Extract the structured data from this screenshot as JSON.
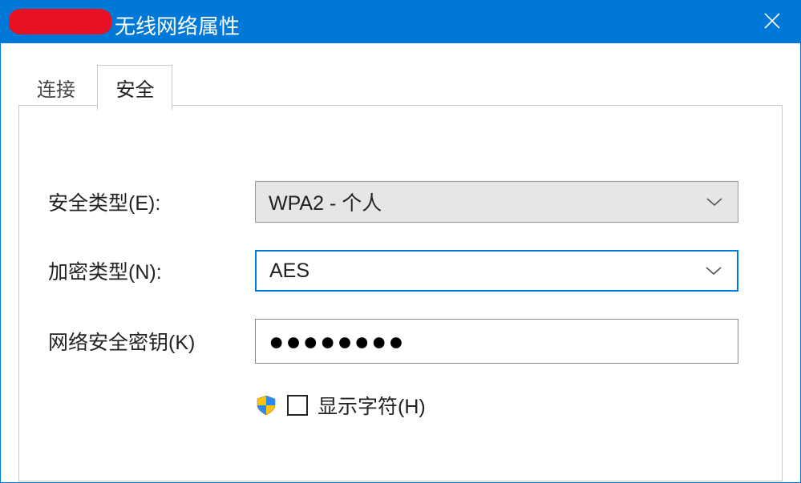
{
  "window": {
    "title": " 无线网络属性"
  },
  "tabs": {
    "connection": "连接",
    "security": "安全"
  },
  "form": {
    "security_type_label": "安全类型(E):",
    "security_type_value": "WPA2 - 个人",
    "encryption_type_label": "加密类型(N):",
    "encryption_type_value": "AES",
    "network_key_label": "网络安全密钥(K)",
    "network_key_value_masked": "●●●●●●●●",
    "show_characters_label": "显示字符(H)"
  }
}
